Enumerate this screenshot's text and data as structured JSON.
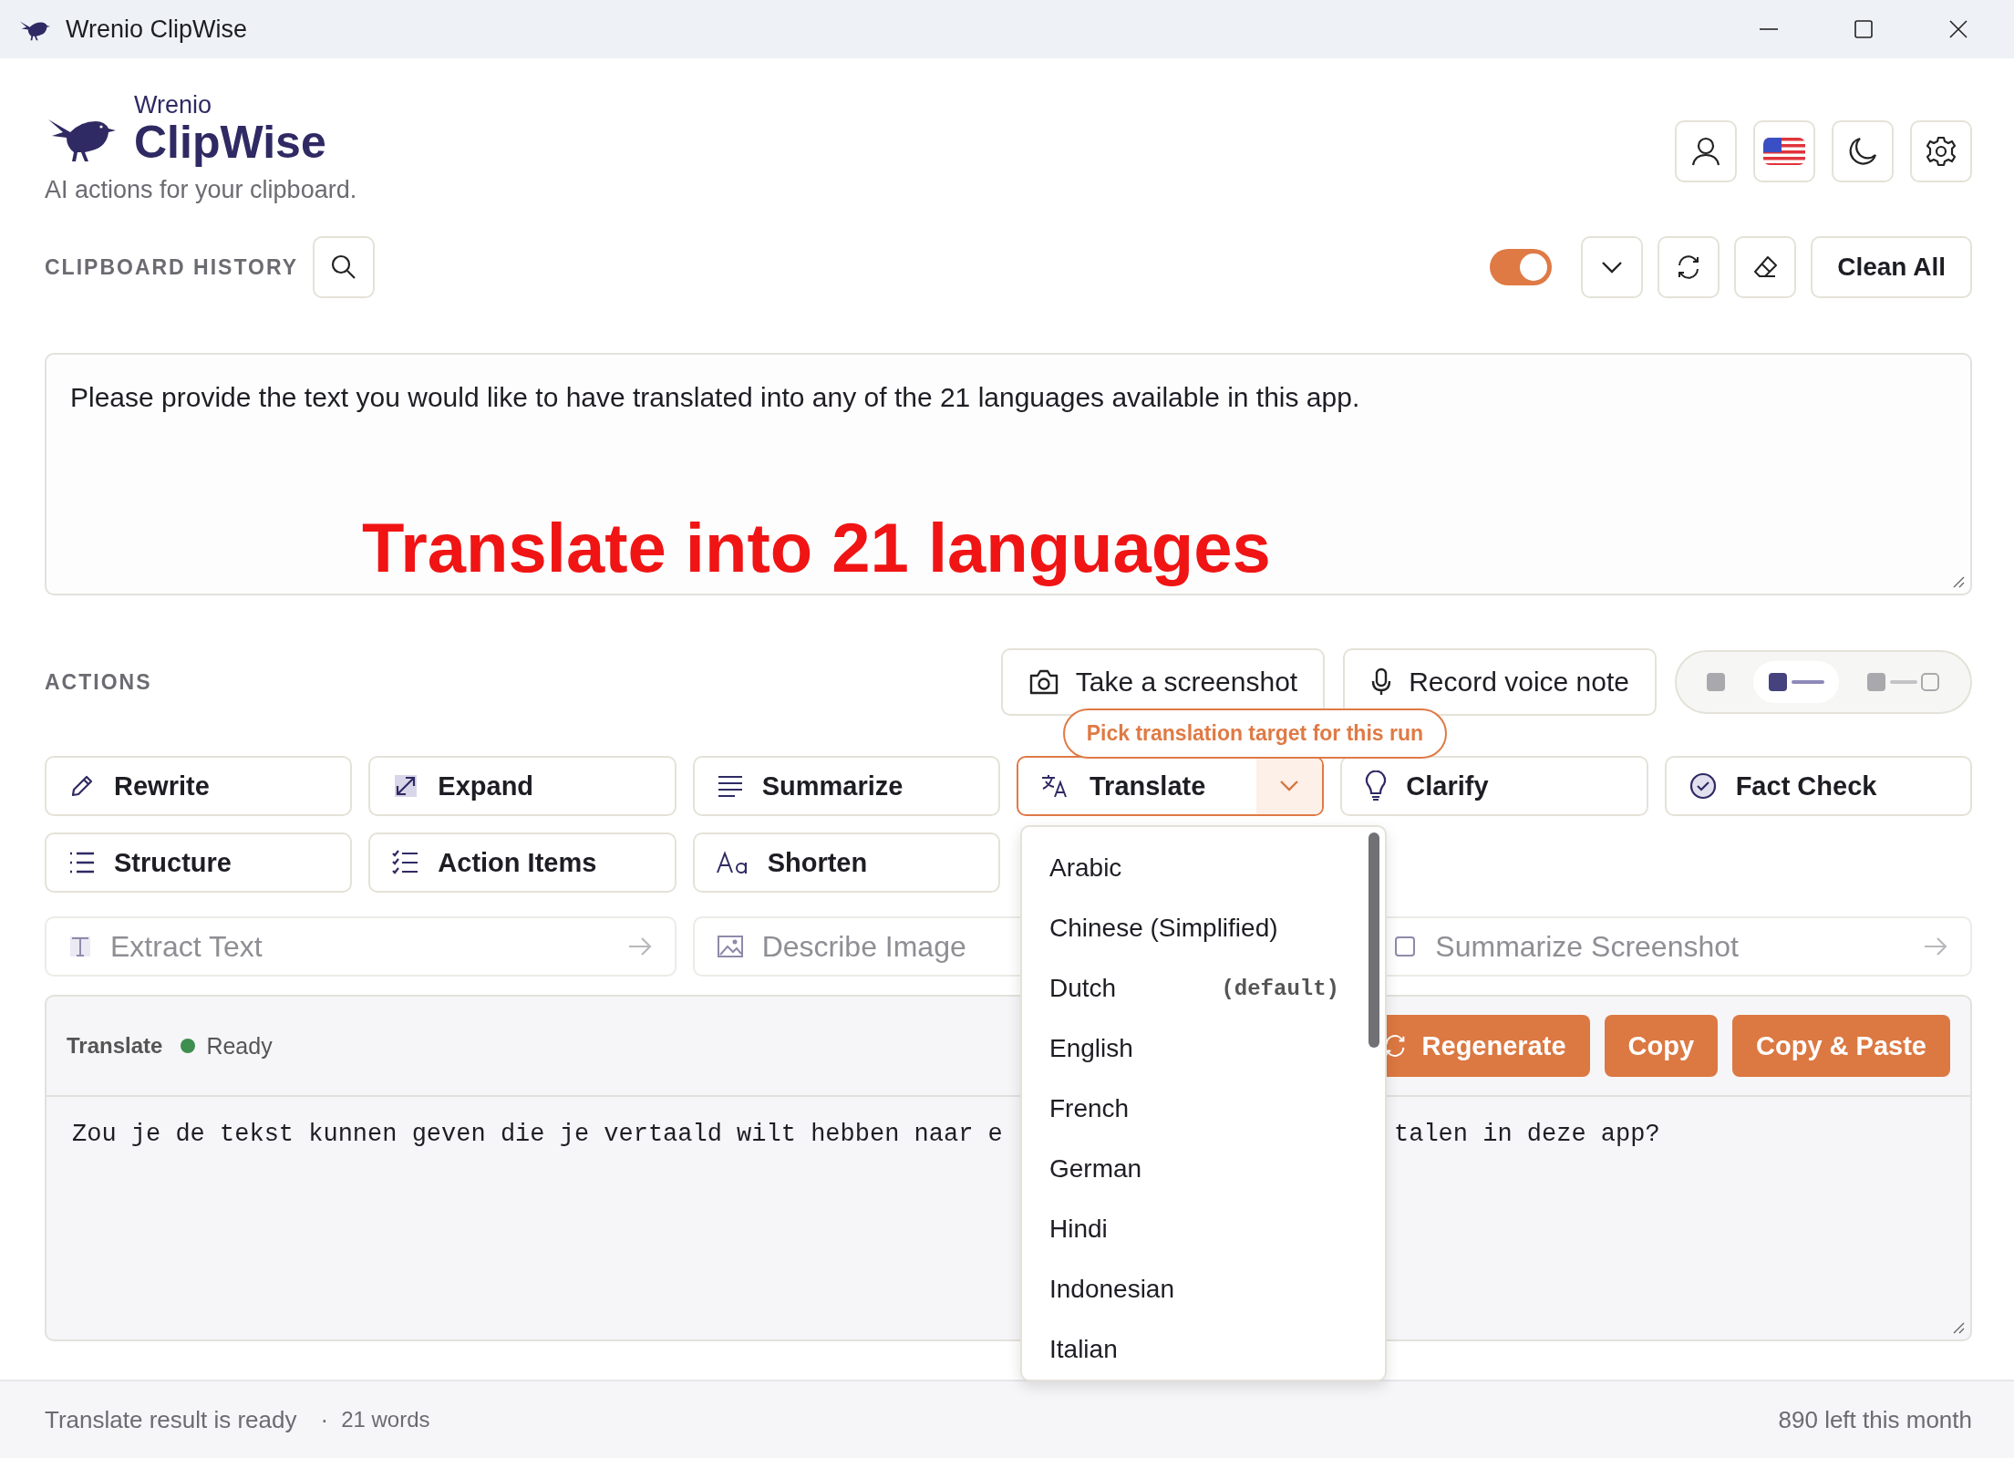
{
  "window": {
    "title": "Wrenio ClipWise"
  },
  "brand": {
    "overline": "Wrenio",
    "name": "ClipWise",
    "tagline": "AI actions for your clipboard."
  },
  "clipboard_history": {
    "label": "CLIPBOARD HISTORY",
    "monitoring_on": true,
    "clean_button": "Clean All",
    "text": "Please provide the text you would like to have translated into any of the 21 languages available in this app.",
    "overlay_caption": "Translate into 21 languages"
  },
  "actions": {
    "label": "ACTIONS",
    "tools": [
      "Take a screenshot",
      "Record voice note"
    ],
    "modes": [
      {
        "kind": "compact",
        "selected": false
      },
      {
        "kind": "medium",
        "selected": true
      },
      {
        "kind": "full",
        "selected": false
      }
    ],
    "tooltip": "Pick translation target for this run",
    "buttons": [
      {
        "label": "Rewrite",
        "kind": "plain"
      },
      {
        "label": "Expand",
        "kind": "plain"
      },
      {
        "label": "Summarize",
        "kind": "plain"
      },
      {
        "label": "Translate",
        "kind": "split",
        "selected": true
      },
      {
        "label": "Clarify",
        "kind": "plain"
      },
      {
        "label": "Fact Check",
        "kind": "plain"
      },
      {
        "label": "Structure",
        "kind": "plain"
      },
      {
        "label": "Action Items",
        "kind": "plain"
      },
      {
        "label": "Shorten",
        "kind": "plain"
      }
    ],
    "media_buttons": [
      {
        "label": "Extract Text",
        "disabled": true
      },
      {
        "label": "Describe Image",
        "disabled": true
      },
      {
        "label": "Summarize Screenshot",
        "disabled": true
      }
    ],
    "language_menu": {
      "options": [
        {
          "label": "Arabic"
        },
        {
          "label": "Chinese (Simplified)"
        },
        {
          "label": "Dutch",
          "note": "(default)"
        },
        {
          "label": "English"
        },
        {
          "label": "French"
        },
        {
          "label": "German"
        },
        {
          "label": "Hindi"
        },
        {
          "label": "Indonesian"
        },
        {
          "label": "Italian"
        }
      ]
    }
  },
  "output": {
    "title": "Translate",
    "status": "Ready",
    "buttons": [
      "Regenerate",
      "Copy",
      "Copy & Paste"
    ],
    "text_parts": [
      "Zou je de tekst kunnen geven die je vertaald wilt hebben naar e",
      "talen in deze app?"
    ]
  },
  "status_bar": {
    "message": "Translate result is ready",
    "separator": "·",
    "words": "21 words",
    "quota": "890 left this month"
  }
}
